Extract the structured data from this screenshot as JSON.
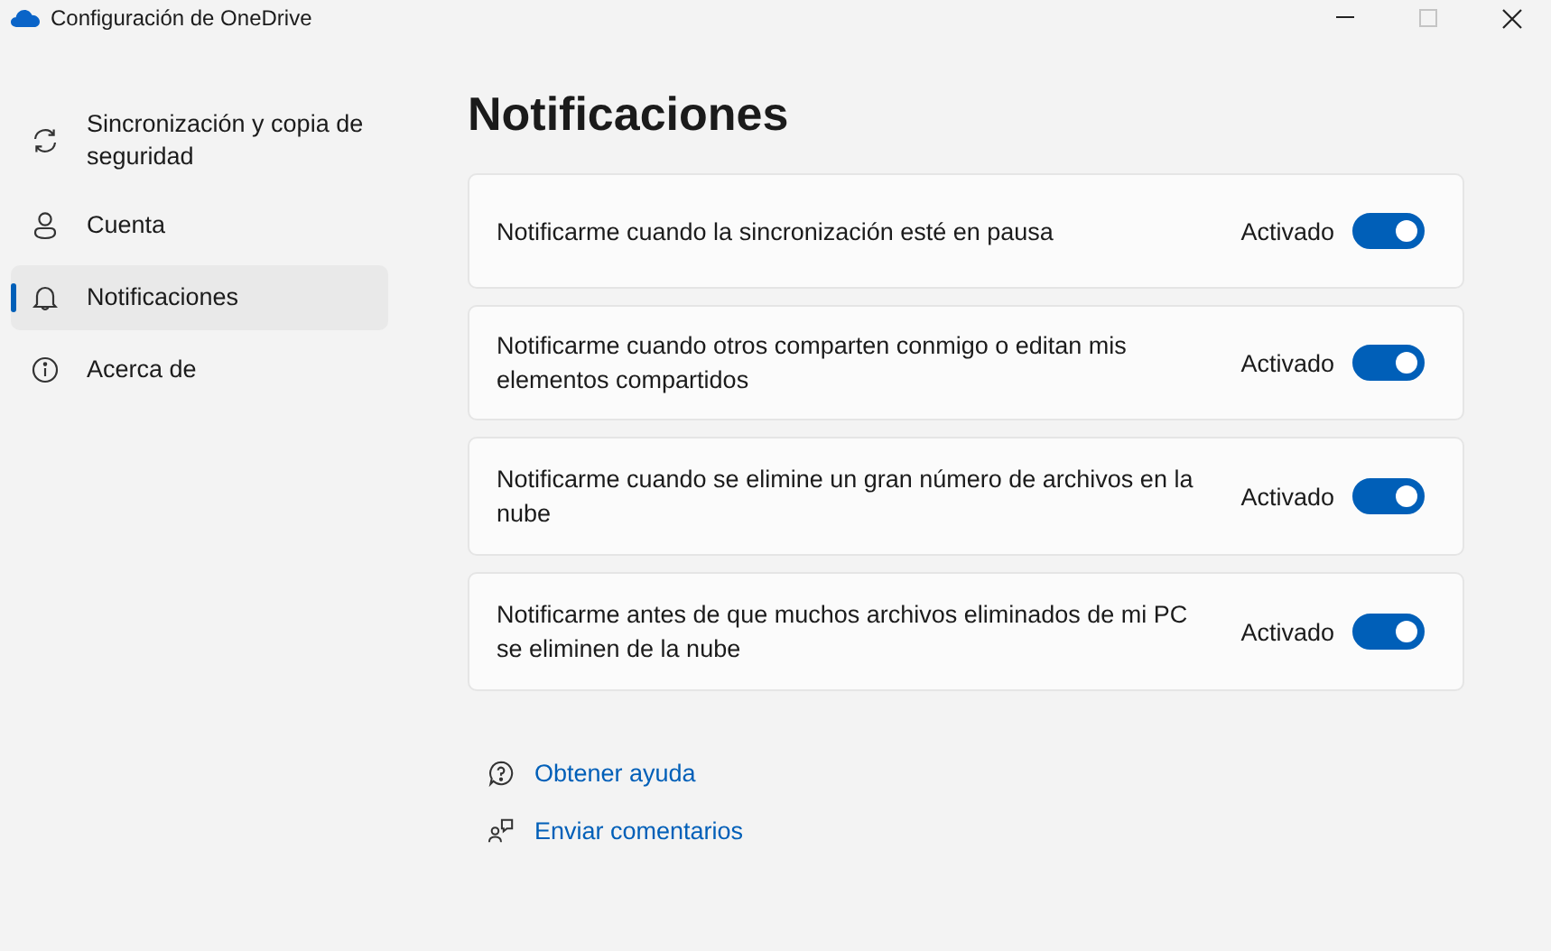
{
  "window": {
    "title": "Configuración de OneDrive",
    "maximize_disabled": true
  },
  "sidebar": {
    "items": [
      {
        "label": "Sincronización y copia de seguridad",
        "selected": false
      },
      {
        "label": "Cuenta",
        "selected": false
      },
      {
        "label": "Notificaciones",
        "selected": true
      },
      {
        "label": "Acerca de",
        "selected": false
      }
    ]
  },
  "page": {
    "title": "Notificaciones",
    "settings": [
      {
        "label": "Notificarme cuando la sincronización esté en pausa",
        "state_label": "Activado",
        "on": true
      },
      {
        "label": "Notificarme cuando otros comparten conmigo o editan mis elementos compartidos",
        "state_label": "Activado",
        "on": true
      },
      {
        "label": "Notificarme cuando se elimine un gran número de archivos en la nube",
        "state_label": "Activado",
        "on": true
      },
      {
        "label": "Notificarme antes de que muchos archivos eliminados de mi PC se eliminen de la nube",
        "state_label": "Activado",
        "on": true
      }
    ],
    "links": [
      "Obtener ayuda",
      "Enviar comentarios"
    ]
  }
}
